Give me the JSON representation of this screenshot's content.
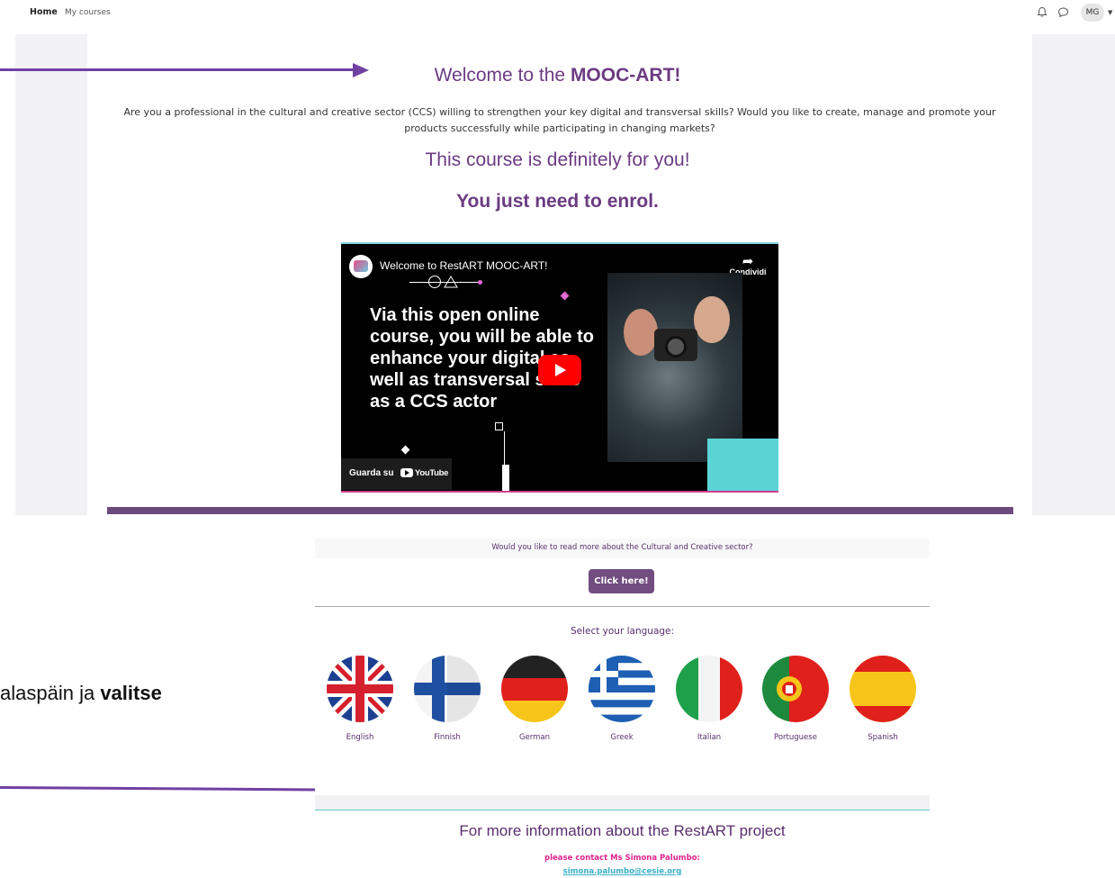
{
  "topnav": {
    "home_label": "Home",
    "courses_label": "My courses",
    "user_initials": "MG"
  },
  "main": {
    "welcome_prefix": "Welcome to the ",
    "welcome_name": "MOOC-ART!",
    "intro": "Are you a professional in the cultural and creative sector (CCS) willing to strengthen your key digital and transversal skills? Would you like to create, manage and promote your products successfully while participating in changing markets?",
    "definitely": "This course is definitely for you!",
    "enrol": "You just need to enrol."
  },
  "video": {
    "title": "Welcome to RestART MOOC-ART!",
    "share_label": "Condividi",
    "overlay_text": "Via this open online course, you will be able to enhance your digital as well as transversal skills as a CCS actor",
    "watch_on": "Guarda su",
    "youtube": "YouTube"
  },
  "ccs": {
    "question": "Would you like to read more about the Cultural and Creative sector?",
    "button_label": "Click here!"
  },
  "languages": {
    "label": "Select your language:",
    "items": [
      "English",
      "Finnish",
      "German",
      "Greek",
      "Italian",
      "Portuguese",
      "Spanish"
    ]
  },
  "side_note": {
    "text_prefix": "alaspäin ja ",
    "text_bold": "valitse"
  },
  "footer": {
    "title": "For more information about the RestART project",
    "contact": "please contact Ms Simona Palumbo:",
    "email": "simona.palumbo@cesie.org"
  },
  "colors": {
    "brand_purple": "#6b3b82",
    "button_purple": "#714d80",
    "arrow_purple": "#7041a3",
    "pink": "#e0238c",
    "teal": "#5bd3d5"
  }
}
